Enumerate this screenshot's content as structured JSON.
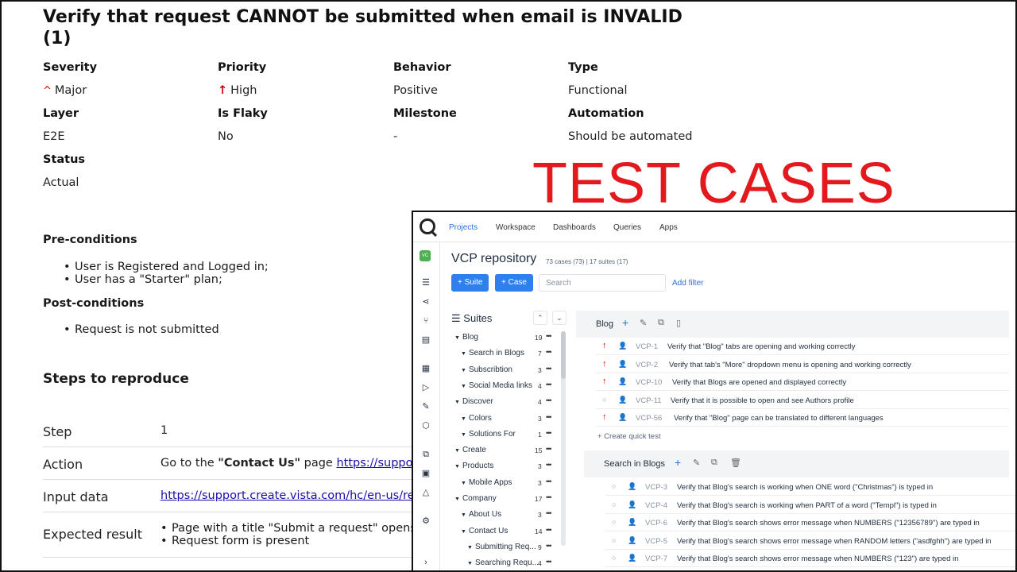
{
  "doc": {
    "title": "Verify that request CANNOT be submitted when email is INVALID (1)",
    "fields": {
      "severity_label": "Severity",
      "severity_value": "Major",
      "priority_label": "Priority",
      "priority_value": "High",
      "behavior_label": "Behavior",
      "behavior_value": "Positive",
      "type_label": "Type",
      "type_value": "Functional",
      "layer_label": "Layer",
      "layer_value": "E2E",
      "flaky_label": "Is Flaky",
      "flaky_value": "No",
      "milestone_label": "Milestone",
      "milestone_value": "-",
      "automation_label": "Automation",
      "automation_value": "Should be automated",
      "status_label": "Status",
      "status_value": "Actual"
    },
    "preconditions_title": "Pre-conditions",
    "preconditions": [
      "User is Registered and Logged in;",
      "User has a \"Starter\" plan;"
    ],
    "postconditions_title": "Post-conditions",
    "postconditions": [
      "Request is not submitted"
    ],
    "steps_title": "Steps to reproduce",
    "step": {
      "step_label": "Step",
      "step_value": "1",
      "action_label": "Action",
      "action_prefix": "Go to the ",
      "action_bold": "\"Contact Us\"",
      "action_mid": " page ",
      "action_link": "https://support.",
      "input_label": "Input data",
      "input_link": "https://support.create.vista.com/hc/en-us/req",
      "expected_label": "Expected result",
      "expected": [
        "Page with a title \"Submit a request\" opens",
        "Request form is present"
      ]
    }
  },
  "overlay_title": "TEST CASES",
  "app": {
    "nav": [
      "Projects",
      "Workspace",
      "Dashboards",
      "Queries",
      "Apps"
    ],
    "project_badge": "VC",
    "repo_title": "VCP repository",
    "repo_meta": "73 cases (73) | 17 suites (17)",
    "suite_btn": "+ Suite",
    "case_btn": "+ Case",
    "search_placeholder": "Search",
    "add_filter": "Add filter",
    "suites_title": "Suites",
    "tree": [
      {
        "label": "Blog",
        "count": "19"
      },
      {
        "label": "Search in Blogs",
        "count": "7"
      },
      {
        "label": "Subscribtion",
        "count": "3"
      },
      {
        "label": "Social Media links",
        "count": "4"
      },
      {
        "label": "Discover",
        "count": "4"
      },
      {
        "label": "Colors",
        "count": "3"
      },
      {
        "label": "Solutions For",
        "count": "1"
      },
      {
        "label": "Create",
        "count": "15"
      },
      {
        "label": "Products",
        "count": "3"
      },
      {
        "label": "Mobile Apps",
        "count": "3"
      },
      {
        "label": "Company",
        "count": "17"
      },
      {
        "label": "About Us",
        "count": "3"
      },
      {
        "label": "Contact Us",
        "count": "14"
      },
      {
        "label": "Submitting Req...",
        "count": "9"
      },
      {
        "label": "Searching Requ...",
        "count": "4"
      }
    ],
    "blog_group": "Blog",
    "blog_cases": [
      {
        "id": "VCP-1",
        "title": "Verify that \"Blog\" tabs are opening and working correctly"
      },
      {
        "id": "VCP-2",
        "title": "Verify that tab's \"More\" dropdown menu is opening and working correctly"
      },
      {
        "id": "VCP-10",
        "title": "Verify that Blogs are opened and displayed correctly"
      },
      {
        "id": "VCP-11",
        "title": "Verify that it is possible to open and see Authors profile"
      },
      {
        "id": "VCP-56",
        "title": "Verify that \"Blog\" page can be translated to different languages"
      }
    ],
    "quick_test": "+ Create quick test",
    "search_group": "Search in Blogs",
    "search_cases": [
      {
        "id": "VCP-3",
        "title": "Verify that Blog's search is working when ONE word (\"Christmas\") is typed in"
      },
      {
        "id": "VCP-4",
        "title": "Verify that Blog's search is working when PART of a word (\"Templ\") is typed in"
      },
      {
        "id": "VCP-6",
        "title": "Verify that Blog's search shows error message when NUMBERS (\"12356789\") are typed in"
      },
      {
        "id": "VCP-5",
        "title": "Verify that Blog's search shows error message when RANDOM letters (\"asdfghh\") are typed in"
      },
      {
        "id": "VCP-7",
        "title": "Verify that Blog's search shows error message when NUMBERS (\"123\") are typed in"
      }
    ]
  }
}
